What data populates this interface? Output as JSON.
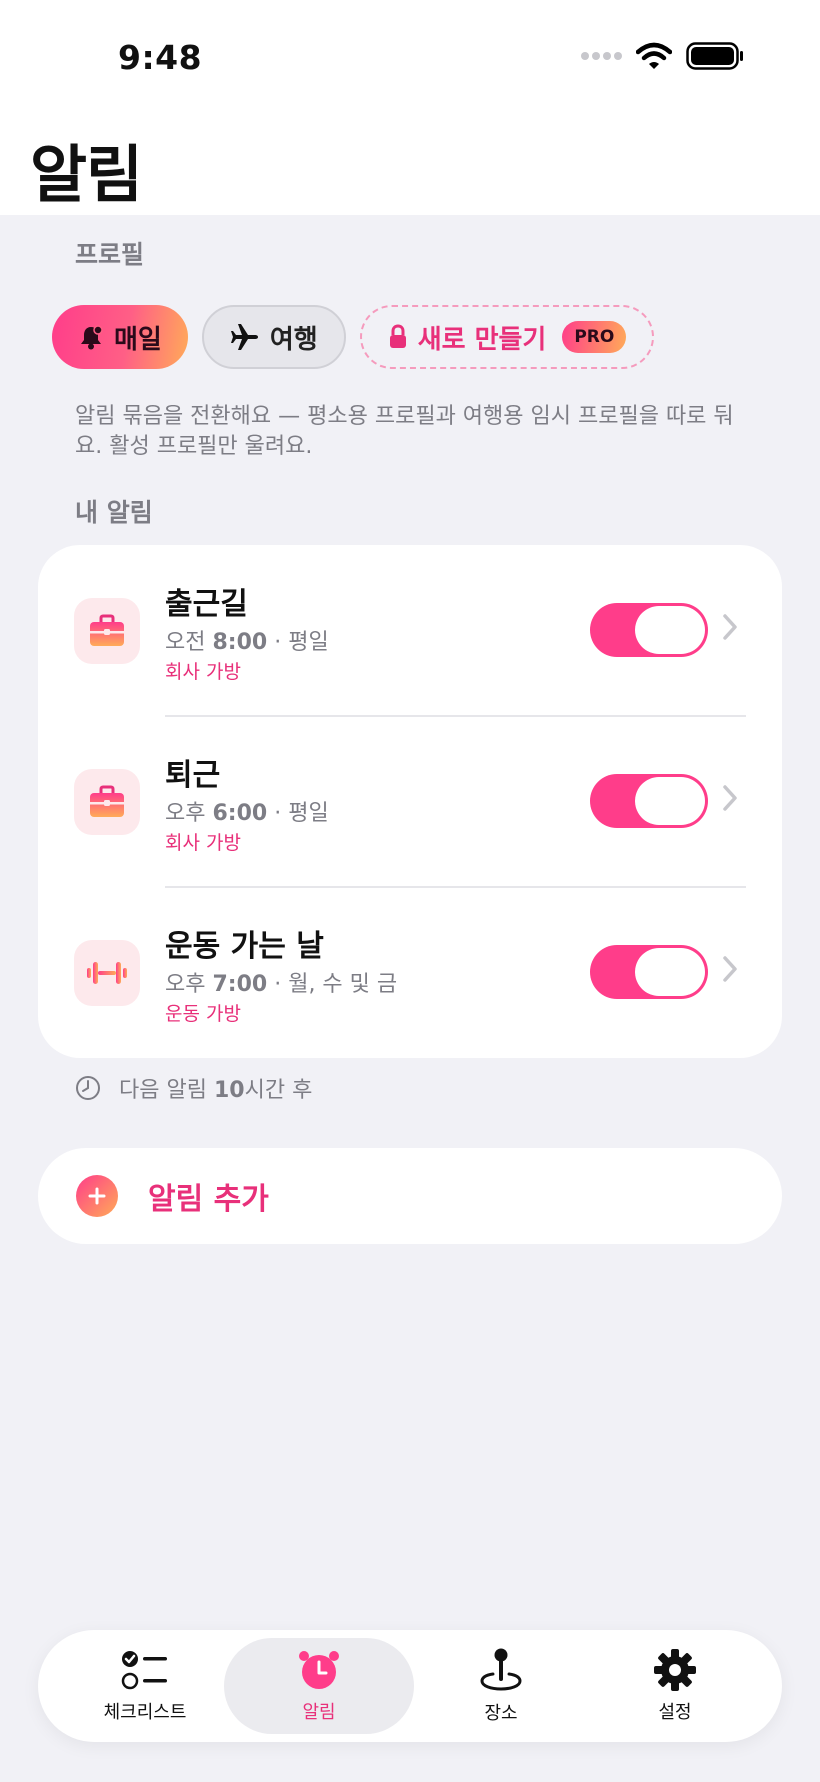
{
  "status_bar": {
    "time": "9:48"
  },
  "header": {
    "title": "알림"
  },
  "profiles": {
    "section_label": "프로필",
    "items": [
      {
        "label": "매일",
        "icon": "bell-icon",
        "active": true
      },
      {
        "label": "여행",
        "icon": "airplane-icon",
        "active": false
      }
    ],
    "new_profile": {
      "label": "새로 만들기",
      "icon": "lock-icon",
      "badge": "PRO"
    },
    "description": "알림 묶음을 전환해요 — 평소용 프로필과 여행용 임시 프로필을 따로 둬요. 활성 프로필만 울려요."
  },
  "alarms": {
    "section_label": "내 알림",
    "items": [
      {
        "title": "출근길",
        "time_prefix": "오전",
        "time": "8:00",
        "days": " · 평일",
        "bag": "회사 가방",
        "icon": "briefcase-icon",
        "enabled": true
      },
      {
        "title": "퇴근",
        "time_prefix": "오후",
        "time": "6:00",
        "days": " · 평일",
        "bag": "회사 가방",
        "icon": "briefcase-icon",
        "enabled": true
      },
      {
        "title": "운동 가는 날",
        "time_prefix": "오후",
        "time": "7:00",
        "days": " · 월, 수 및 금",
        "bag": "운동 가방",
        "icon": "dumbbell-icon",
        "enabled": true
      }
    ]
  },
  "next_alarm": {
    "prefix": "다음 알림",
    "hours": "10",
    "suffix": "시간 후",
    "icon": "clock-icon"
  },
  "add_alarm": {
    "label": "알림 추가",
    "icon": "plus-icon"
  },
  "tab_bar": {
    "items": [
      {
        "label": "체크리스트",
        "icon": "checklist-icon",
        "active": false
      },
      {
        "label": "알림",
        "icon": "alarm-clock-icon",
        "active": true
      },
      {
        "label": "장소",
        "icon": "location-pin-icon",
        "active": false
      },
      {
        "label": "설정",
        "icon": "gear-icon",
        "active": false
      }
    ]
  },
  "colors": {
    "accent": "#ff3d8a",
    "accent_gradient_end": "#ffab58",
    "text_accent": "#e8307a",
    "background": "#f1f1f6"
  }
}
